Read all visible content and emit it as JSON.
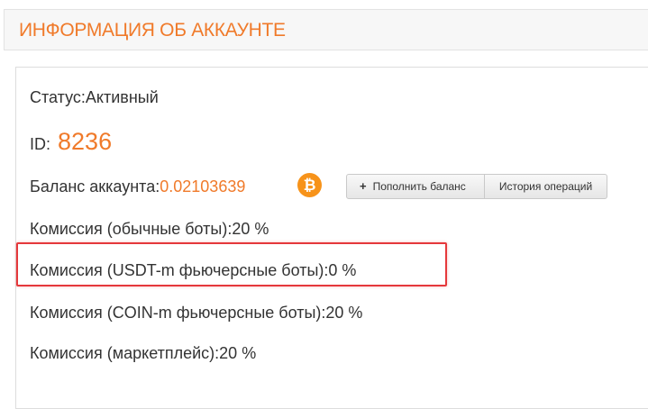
{
  "header": {
    "title": "ИНФОРМАЦИЯ ОБ АККАУНТЕ"
  },
  "account": {
    "status_label": "Статус:",
    "status_value": "Активный",
    "id_label": "ID:",
    "id_value": "8236",
    "balance_label": "Баланс аккаунта:",
    "balance_value": "0.02103639",
    "currency_icon": "bitcoin-icon"
  },
  "buttons": {
    "topup_icon": "plus-icon",
    "topup_label": "Пополнить баланс",
    "history_label": "История операций"
  },
  "commissions": [
    {
      "label": "Комиссия (обычные боты):",
      "value": "20 %"
    },
    {
      "label": "Комиссия (USDT-m фьючерсные боты):",
      "value": "0 %"
    },
    {
      "label": "Комиссия (COIN-m фьючерсные боты):",
      "value": "20 %"
    },
    {
      "label": "Комиссия (маркетплейс):",
      "value": "20 %"
    }
  ],
  "colors": {
    "accent": "#f07a2a",
    "bitcoin": "#f7931a",
    "highlight": "#e5383b"
  }
}
